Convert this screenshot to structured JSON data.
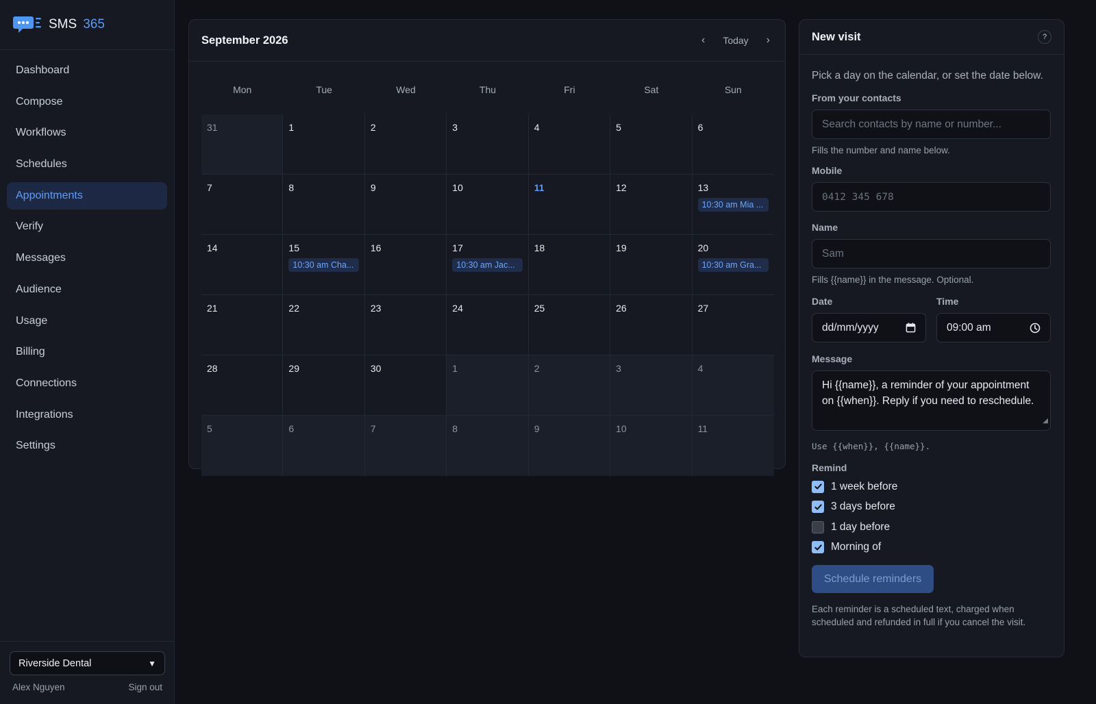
{
  "brand": {
    "name": "SMS",
    "number": "365"
  },
  "nav": [
    {
      "label": "Dashboard"
    },
    {
      "label": "Compose"
    },
    {
      "label": "Workflows"
    },
    {
      "label": "Schedules"
    },
    {
      "label": "Appointments",
      "active": true
    },
    {
      "label": "Verify"
    },
    {
      "label": "Messages"
    },
    {
      "label": "Audience"
    },
    {
      "label": "Usage"
    },
    {
      "label": "Billing"
    },
    {
      "label": "Connections"
    },
    {
      "label": "Integrations"
    },
    {
      "label": "Settings"
    }
  ],
  "account": {
    "selected": "Riverside Dental",
    "user": "Alex Nguyen",
    "sign_out": "Sign out"
  },
  "calendar": {
    "title": "September 2026",
    "prev": "‹",
    "today": "Today",
    "next": "›",
    "weekdays": [
      "Mon",
      "Tue",
      "Wed",
      "Thu",
      "Fri",
      "Sat",
      "Sun"
    ],
    "weeks": [
      [
        {
          "d": "31",
          "m": true
        },
        {
          "d": "1"
        },
        {
          "d": "2"
        },
        {
          "d": "3"
        },
        {
          "d": "4"
        },
        {
          "d": "5"
        },
        {
          "d": "6"
        }
      ],
      [
        {
          "d": "7"
        },
        {
          "d": "8"
        },
        {
          "d": "9"
        },
        {
          "d": "10"
        },
        {
          "d": "11",
          "today": true
        },
        {
          "d": "12"
        },
        {
          "d": "13",
          "e": "10:30 am Mia ..."
        }
      ],
      [
        {
          "d": "14"
        },
        {
          "d": "15",
          "e": "10:30 am Cha..."
        },
        {
          "d": "16"
        },
        {
          "d": "17",
          "e": "10:30 am Jac..."
        },
        {
          "d": "18"
        },
        {
          "d": "19"
        },
        {
          "d": "20",
          "e": "10:30 am Gra..."
        }
      ],
      [
        {
          "d": "21"
        },
        {
          "d": "22"
        },
        {
          "d": "23"
        },
        {
          "d": "24"
        },
        {
          "d": "25"
        },
        {
          "d": "26"
        },
        {
          "d": "27"
        }
      ],
      [
        {
          "d": "28"
        },
        {
          "d": "29"
        },
        {
          "d": "30"
        },
        {
          "d": "1",
          "m": true
        },
        {
          "d": "2",
          "m": true
        },
        {
          "d": "3",
          "m": true
        },
        {
          "d": "4",
          "m": true
        }
      ],
      [
        {
          "d": "5",
          "m": true
        },
        {
          "d": "6",
          "m": true
        },
        {
          "d": "7",
          "m": true
        },
        {
          "d": "8",
          "m": true
        },
        {
          "d": "9",
          "m": true
        },
        {
          "d": "10",
          "m": true
        },
        {
          "d": "11",
          "m": true
        }
      ]
    ]
  },
  "form": {
    "title": "New visit",
    "help": "?",
    "intro": "Pick a day on the calendar, or set the date below.",
    "contacts_label": "From your contacts",
    "contacts_placeholder": "Search contacts by name or number...",
    "contacts_hint": "Fills the number and name below.",
    "mobile_label": "Mobile",
    "mobile_placeholder": "0412 345 678",
    "name_label": "Name",
    "name_placeholder": "Sam",
    "name_hint": "Fills {{name}} in the message. Optional.",
    "date_label": "Date",
    "date_value": "dd/mm/yyyy",
    "time_label": "Time",
    "time_value": "09:00 am",
    "message_label": "Message",
    "message_value": "Hi {{name}}, a reminder of your appointment on {{when}}. Reply if you need to reschedule.",
    "message_hint": "Use {{when}}, {{name}}.",
    "remind_label": "Remind",
    "reminders": [
      {
        "label": "1 week before",
        "checked": true
      },
      {
        "label": "3 days before",
        "checked": true
      },
      {
        "label": "1 day before",
        "checked": false
      },
      {
        "label": "Morning of",
        "checked": true
      }
    ],
    "submit": "Schedule reminders",
    "footnote": "Each reminder is a scheduled text, charged when scheduled and refunded in full if you cancel the visit."
  },
  "colors": {
    "accent": "#5b9bf5",
    "background": "#101117",
    "panel": "#161922"
  }
}
